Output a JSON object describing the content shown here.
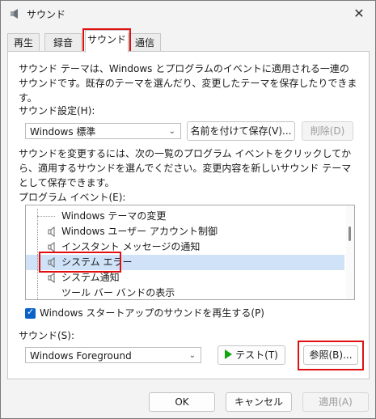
{
  "window": {
    "title": "サウンド",
    "icons": {
      "app": "sound-icon",
      "close": "close-icon"
    }
  },
  "tabs": [
    {
      "label": "再生"
    },
    {
      "label": "録音"
    },
    {
      "label": "サウンド"
    },
    {
      "label": "通信"
    }
  ],
  "description": "サウンド テーマは、Windows とプログラムのイベントに適用される一連のサウンドです。既存のテーマを選んだり、変更したテーマを保存したりできます。",
  "scheme": {
    "label": "サウンド設定(H):",
    "selected": "Windows 標準",
    "save_button": "名前を付けて保存(V)...",
    "delete_button": "削除(D)"
  },
  "instructions": "サウンドを変更するには、次の一覧のプログラム イベントをクリックしてから、適用するサウンドを選んでください。変更内容を新しいサウンド テーマとして保存できます。",
  "events": {
    "label": "プログラム イベント(E):",
    "items": [
      {
        "label": "Windows テーマの変更",
        "has_sound": false
      },
      {
        "label": "Windows ユーザー アカウント制御",
        "has_sound": true
      },
      {
        "label": "インスタント メッセージの通知",
        "has_sound": true
      },
      {
        "label": "システム エラー",
        "has_sound": true,
        "selected": true
      },
      {
        "label": "システム通知",
        "has_sound": true
      },
      {
        "label": "ツール バー バンドの表示",
        "has_sound": false
      }
    ]
  },
  "startup_checkbox": {
    "label": "Windows スタートアップのサウンドを再生する(P)",
    "checked": true
  },
  "sound": {
    "label": "サウンド(S):",
    "selected": "Windows Foreground",
    "test_button": "テスト(T)",
    "browse_button": "参照(B)..."
  },
  "footer": {
    "ok": "OK",
    "cancel": "キャンセル",
    "apply": "適用(A)"
  },
  "colors": {
    "highlight": "#e01010",
    "accent": "#0b63c6",
    "selection": "#cfe2f7"
  }
}
